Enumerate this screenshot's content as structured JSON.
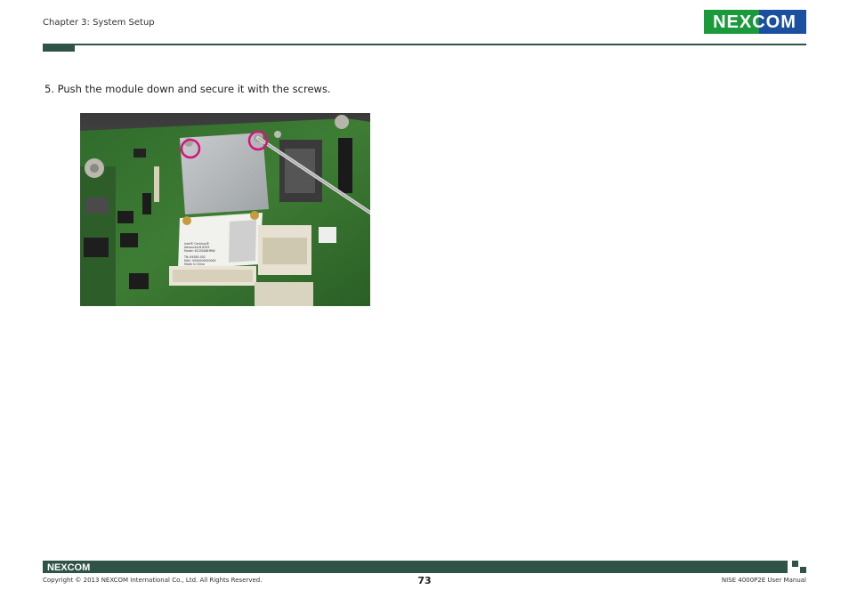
{
  "header": {
    "chapter": "Chapter 3: System Setup",
    "logo_text": "NEXCOM",
    "logo_color": "#1a9a3b",
    "accent_color": "#2f5347",
    "logo_blue": "#1b4fa0"
  },
  "content": {
    "step_text": "5. Push the module down and secure it with the screws.",
    "photo_icon": "wireless-module-installation-photo",
    "module_label_lines": [
      "Intel® Centrino®",
      "Advanced-N 6205",
      "Model: 62205ANHMW",
      "TN: 84585-002",
      "MAC: 0000000000000",
      "Made in China"
    ]
  },
  "footer": {
    "logo_text": "NEXCOM",
    "copyright": "Copyright © 2013 NEXCOM International Co., Ltd. All Rights Reserved.",
    "page_number": "73",
    "manual_title": "NISE 4000P2E User Manual"
  }
}
